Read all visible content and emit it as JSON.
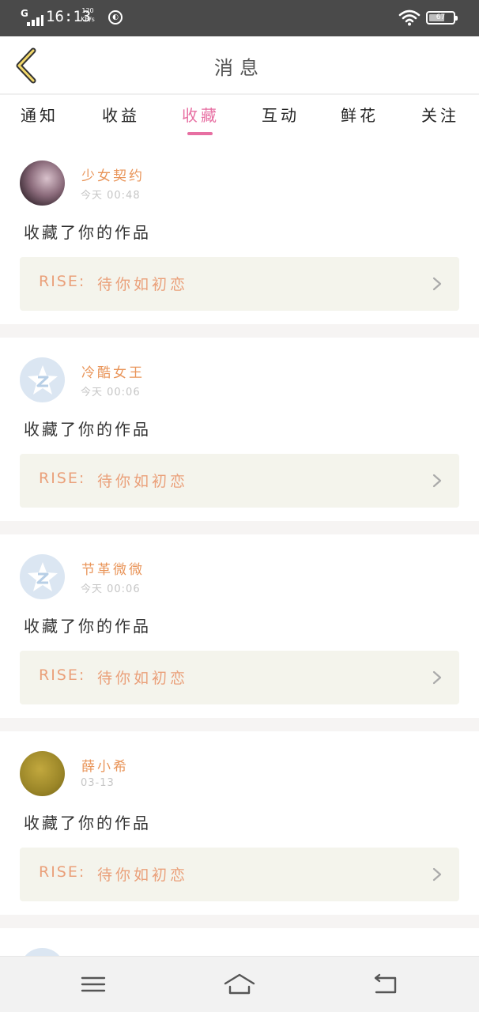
{
  "status_bar": {
    "network": "G",
    "time": "16:13",
    "speed_value": "120",
    "speed_unit": "KB/s",
    "battery": "67"
  },
  "header": {
    "title": "消息"
  },
  "tabs": [
    {
      "label": "通知",
      "active": false
    },
    {
      "label": "收益",
      "active": false
    },
    {
      "label": "收藏",
      "active": true
    },
    {
      "label": "互动",
      "active": false
    },
    {
      "label": "鲜花",
      "active": false
    },
    {
      "label": "关注",
      "active": false
    }
  ],
  "feed": [
    {
      "user": "少女契约",
      "time": "今天 00:48",
      "action": "收藏了你的作品",
      "work_label": "RISE:",
      "work_title": "待你如初恋",
      "avatar": "photo"
    },
    {
      "user": "冷酷女王",
      "time": "今天 00:06",
      "action": "收藏了你的作品",
      "work_label": "RISE:",
      "work_title": "待你如初恋",
      "avatar": "default"
    },
    {
      "user": "节革微微",
      "time": "今天 00:06",
      "action": "收藏了你的作品",
      "work_label": "RISE:",
      "work_title": "待你如初恋",
      "avatar": "default"
    },
    {
      "user": "薛小希",
      "time": "03-13",
      "action": "收藏了你的作品",
      "work_label": "RISE:",
      "work_title": "待你如初恋",
      "avatar": "ball"
    }
  ],
  "colors": {
    "accent": "#e76fa2",
    "name": "#e9955a",
    "work": "#eaa07a"
  },
  "icons": {
    "back": "chevron-left-icon",
    "menu": "menu-icon",
    "home": "home-icon",
    "return": "return-icon"
  }
}
